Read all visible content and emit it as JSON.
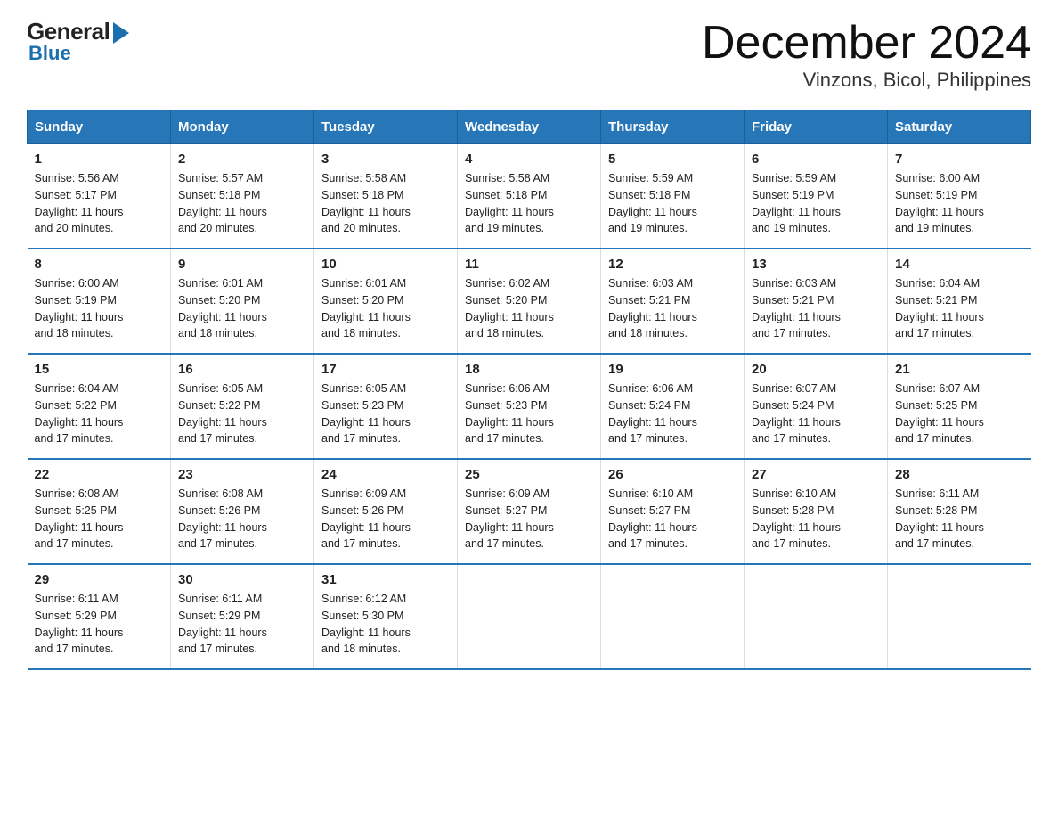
{
  "logo": {
    "general": "General",
    "blue": "Blue"
  },
  "header": {
    "month": "December 2024",
    "location": "Vinzons, Bicol, Philippines"
  },
  "days_of_week": [
    "Sunday",
    "Monday",
    "Tuesday",
    "Wednesday",
    "Thursday",
    "Friday",
    "Saturday"
  ],
  "weeks": [
    [
      {
        "day": "1",
        "sunrise": "5:56 AM",
        "sunset": "5:17 PM",
        "daylight": "11 hours and 20 minutes."
      },
      {
        "day": "2",
        "sunrise": "5:57 AM",
        "sunset": "5:18 PM",
        "daylight": "11 hours and 20 minutes."
      },
      {
        "day": "3",
        "sunrise": "5:58 AM",
        "sunset": "5:18 PM",
        "daylight": "11 hours and 20 minutes."
      },
      {
        "day": "4",
        "sunrise": "5:58 AM",
        "sunset": "5:18 PM",
        "daylight": "11 hours and 19 minutes."
      },
      {
        "day": "5",
        "sunrise": "5:59 AM",
        "sunset": "5:18 PM",
        "daylight": "11 hours and 19 minutes."
      },
      {
        "day": "6",
        "sunrise": "5:59 AM",
        "sunset": "5:19 PM",
        "daylight": "11 hours and 19 minutes."
      },
      {
        "day": "7",
        "sunrise": "6:00 AM",
        "sunset": "5:19 PM",
        "daylight": "11 hours and 19 minutes."
      }
    ],
    [
      {
        "day": "8",
        "sunrise": "6:00 AM",
        "sunset": "5:19 PM",
        "daylight": "11 hours and 18 minutes."
      },
      {
        "day": "9",
        "sunrise": "6:01 AM",
        "sunset": "5:20 PM",
        "daylight": "11 hours and 18 minutes."
      },
      {
        "day": "10",
        "sunrise": "6:01 AM",
        "sunset": "5:20 PM",
        "daylight": "11 hours and 18 minutes."
      },
      {
        "day": "11",
        "sunrise": "6:02 AM",
        "sunset": "5:20 PM",
        "daylight": "11 hours and 18 minutes."
      },
      {
        "day": "12",
        "sunrise": "6:03 AM",
        "sunset": "5:21 PM",
        "daylight": "11 hours and 18 minutes."
      },
      {
        "day": "13",
        "sunrise": "6:03 AM",
        "sunset": "5:21 PM",
        "daylight": "11 hours and 17 minutes."
      },
      {
        "day": "14",
        "sunrise": "6:04 AM",
        "sunset": "5:21 PM",
        "daylight": "11 hours and 17 minutes."
      }
    ],
    [
      {
        "day": "15",
        "sunrise": "6:04 AM",
        "sunset": "5:22 PM",
        "daylight": "11 hours and 17 minutes."
      },
      {
        "day": "16",
        "sunrise": "6:05 AM",
        "sunset": "5:22 PM",
        "daylight": "11 hours and 17 minutes."
      },
      {
        "day": "17",
        "sunrise": "6:05 AM",
        "sunset": "5:23 PM",
        "daylight": "11 hours and 17 minutes."
      },
      {
        "day": "18",
        "sunrise": "6:06 AM",
        "sunset": "5:23 PM",
        "daylight": "11 hours and 17 minutes."
      },
      {
        "day": "19",
        "sunrise": "6:06 AM",
        "sunset": "5:24 PM",
        "daylight": "11 hours and 17 minutes."
      },
      {
        "day": "20",
        "sunrise": "6:07 AM",
        "sunset": "5:24 PM",
        "daylight": "11 hours and 17 minutes."
      },
      {
        "day": "21",
        "sunrise": "6:07 AM",
        "sunset": "5:25 PM",
        "daylight": "11 hours and 17 minutes."
      }
    ],
    [
      {
        "day": "22",
        "sunrise": "6:08 AM",
        "sunset": "5:25 PM",
        "daylight": "11 hours and 17 minutes."
      },
      {
        "day": "23",
        "sunrise": "6:08 AM",
        "sunset": "5:26 PM",
        "daylight": "11 hours and 17 minutes."
      },
      {
        "day": "24",
        "sunrise": "6:09 AM",
        "sunset": "5:26 PM",
        "daylight": "11 hours and 17 minutes."
      },
      {
        "day": "25",
        "sunrise": "6:09 AM",
        "sunset": "5:27 PM",
        "daylight": "11 hours and 17 minutes."
      },
      {
        "day": "26",
        "sunrise": "6:10 AM",
        "sunset": "5:27 PM",
        "daylight": "11 hours and 17 minutes."
      },
      {
        "day": "27",
        "sunrise": "6:10 AM",
        "sunset": "5:28 PM",
        "daylight": "11 hours and 17 minutes."
      },
      {
        "day": "28",
        "sunrise": "6:11 AM",
        "sunset": "5:28 PM",
        "daylight": "11 hours and 17 minutes."
      }
    ],
    [
      {
        "day": "29",
        "sunrise": "6:11 AM",
        "sunset": "5:29 PM",
        "daylight": "11 hours and 17 minutes."
      },
      {
        "day": "30",
        "sunrise": "6:11 AM",
        "sunset": "5:29 PM",
        "daylight": "11 hours and 17 minutes."
      },
      {
        "day": "31",
        "sunrise": "6:12 AM",
        "sunset": "5:30 PM",
        "daylight": "11 hours and 18 minutes."
      },
      null,
      null,
      null,
      null
    ]
  ],
  "labels": {
    "sunrise": "Sunrise:",
    "sunset": "Sunset:",
    "daylight": "Daylight:"
  }
}
